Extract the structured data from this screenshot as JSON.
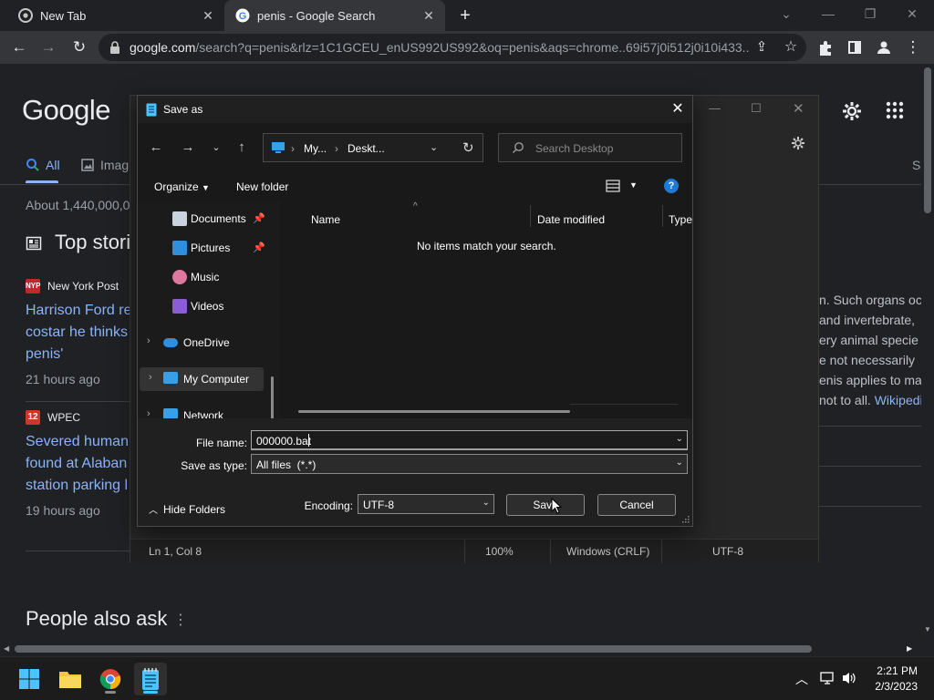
{
  "browser": {
    "tabs": [
      {
        "title": "New Tab"
      },
      {
        "title": "penis - Google Search"
      }
    ],
    "url_host": "google.com",
    "url_rest": "/search?q=penis&rlz=1C1GCEU_enUS992US992&oq=penis&aqs=chrome..69i57j0i512j0i10i433..."
  },
  "google": {
    "logo": "Google",
    "tabs": {
      "all": "All",
      "images": "Imag"
    },
    "about": "About 1,440,000,0",
    "top_stories": "Top stori",
    "stories": [
      {
        "source": "New York Post",
        "headline1": "Harrison Ford re",
        "headline2": "costar he thinks",
        "headline3": "penis'",
        "ago": "21 hours ago"
      },
      {
        "source": "WPEC",
        "headline1": "Severed human",
        "headline2": "found at Alaban",
        "headline3": "station parking l",
        "ago": "19 hours ago"
      }
    ],
    "snippet": [
      "n. Such organs oc",
      "and invertebrate,",
      "ery animal specie",
      "e not necessarily",
      "enis applies to ma",
      "not to all."
    ],
    "snippet_link": "Wikipedi",
    "s_letter": "S",
    "people_also_ask": "People also ask"
  },
  "notepad": {
    "status": {
      "pos": "Ln 1, Col 8",
      "zoom": "100%",
      "eol": "Windows (CRLF)",
      "enc": "UTF-8"
    }
  },
  "dialog": {
    "title": "Save as",
    "path": [
      "My...",
      "Deskt..."
    ],
    "search_placeholder": "Search Desktop",
    "organize": "Organize",
    "new_folder": "New folder",
    "nav_items": [
      {
        "label": "Documents"
      },
      {
        "label": "Pictures"
      },
      {
        "label": "Music"
      },
      {
        "label": "Videos"
      },
      {
        "label": "OneDrive"
      },
      {
        "label": "My Computer"
      },
      {
        "label": "Network"
      }
    ],
    "columns": {
      "name": "Name",
      "date": "Date modified",
      "type": "Type"
    },
    "empty_message": "No items match your search.",
    "file_name_label": "File name:",
    "file_name_value": "000000.bat",
    "save_type_label": "Save as type:",
    "save_type_value": "All files  (*.*)",
    "encoding_label": "Encoding:",
    "encoding_value": "UTF-8",
    "save_button": "Save",
    "cancel_button": "Cancel",
    "hide_folders": "Hide Folders"
  },
  "taskbar": {
    "time": "2:21 PM",
    "date": "2/3/2023"
  },
  "colors": {
    "link": "#8ab4f8",
    "accent": "#1f7ad6"
  }
}
